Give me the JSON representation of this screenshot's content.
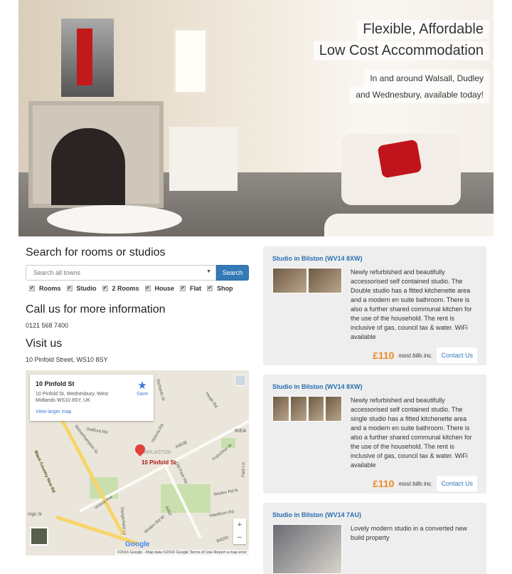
{
  "hero": {
    "title_line1": "Flexible, Affordable",
    "title_line2": "Low Cost Accommodation",
    "sub_line1": "In and around Walsall, Dudley",
    "sub_line2": "and Wednesbury, available today!"
  },
  "search": {
    "heading": "Search for rooms or studios",
    "placeholder": "Search all towns",
    "button": "Search",
    "filters": [
      {
        "label": "Rooms",
        "checked": true
      },
      {
        "label": "Studio",
        "checked": true
      },
      {
        "label": "2 Rooms",
        "checked": true
      },
      {
        "label": "House",
        "checked": true
      },
      {
        "label": "Flat",
        "checked": true
      },
      {
        "label": "Shop",
        "checked": true
      }
    ]
  },
  "call": {
    "heading": "Call us for more information",
    "phone": "0121 568 7400"
  },
  "visit": {
    "heading": "Visit us",
    "address": "10 Pinfold Street, WS10 8SY"
  },
  "map": {
    "place": "10 Pinfold St",
    "address": "10 Pinfold St, Wednesbury, West Midlands WS10 8SY, UK",
    "larger": "View larger map",
    "save": "Save",
    "pin_label": "10 Pinfold St",
    "area": "DARLASTON",
    "ikea": "IKEA",
    "logo": "Google",
    "footer": "©2016 Google - Map data ©2016 Google   Terms of Use   Report a map error",
    "zoom_in": "+",
    "zoom_out": "−",
    "roads": [
      "Black Country New Rd",
      "Wolverhampton St",
      "Stafford Rd",
      "Victoria Rd",
      "A4038",
      "Old Park Rd",
      "Franchise St",
      "Heath Rd",
      "Richards St",
      "Woden Rd N",
      "Hawthorn Rd",
      "A462",
      "Woden Rd W",
      "Victory Ave",
      "Dangerfield Ln",
      "High St",
      "Park Ln",
      "B4200"
    ]
  },
  "listings": [
    {
      "title": "Studio in Bilston (WV14 8XW)",
      "desc": "Newly refurbished and beautifully accessorised self contained studio. The Double studio has a fitted kitchenette area and a modern en suite bathroom. There is also a further shared communal kitchen for the use of the household. The rent is inclusive of gas, council tax & water. WiFi available",
      "price": "£110",
      "bills": "most bills inc.",
      "contact": "Contact Us"
    },
    {
      "title": "Studio in Bilston (WV14 8XW)",
      "desc": "Newly refurbished and beautifully accessorised self contained studio. The single studio has a fitted kitchenette area and a modern en suite bathroom. There is also a further shared communal kitchen for the use of the household. The rent is inclusive of gas, council tax & water. WiFi available",
      "price": "£110",
      "bills": "most bills inc.",
      "contact": "Contact Us"
    },
    {
      "title": "Studio in Bilston (WV14 7AU)",
      "desc": "Lovely modern studio in a converted new build property"
    }
  ]
}
